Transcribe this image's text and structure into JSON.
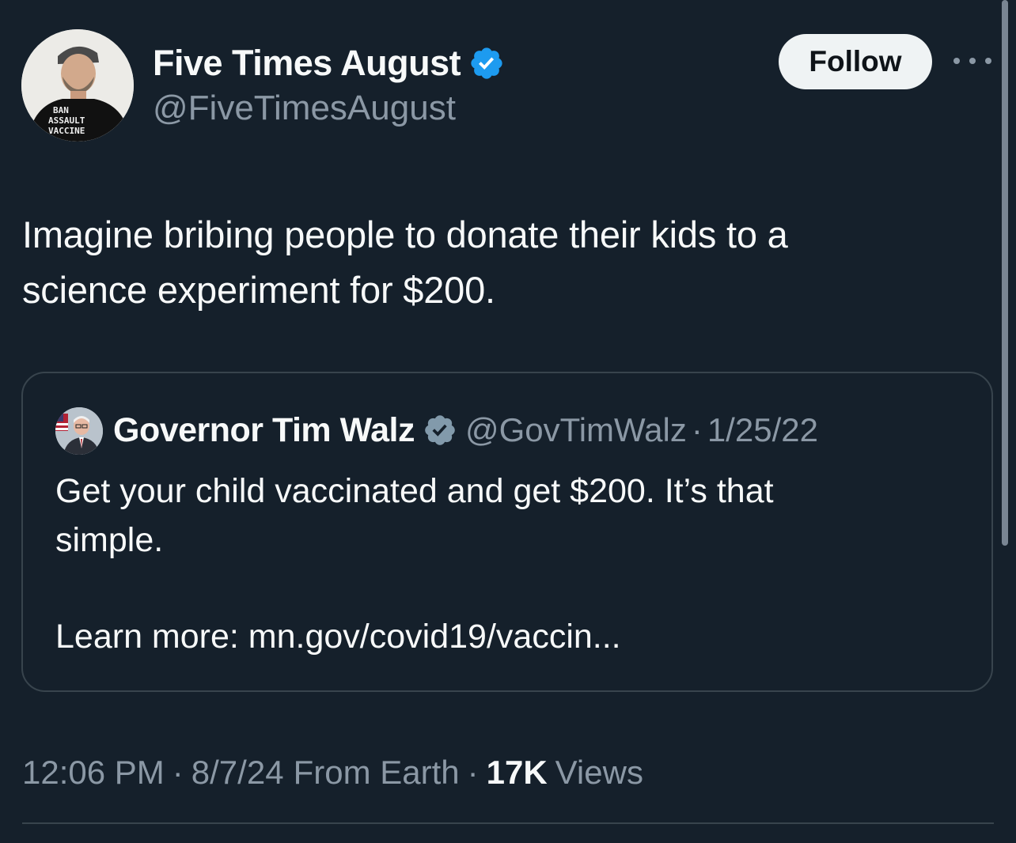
{
  "tweet": {
    "author": {
      "display_name": "Five Times August",
      "handle": "@FiveTimesAugust",
      "verified_icon": "verified-badge-icon",
      "avatar_shirt_text": [
        "BAN",
        "ASSAULT",
        "VACCINE"
      ]
    },
    "follow_label": "Follow",
    "more_icon": "more-horizontal-icon",
    "text_lines": [
      "Imagine bribing people to donate their kids to a",
      "science experiment for $200."
    ],
    "quote": {
      "display_name": "Governor Tim Walz",
      "handle": "@GovTimWalz",
      "separator": "·",
      "date": "1/25/22",
      "verified_icon": "verified-badge-icon",
      "body_lines": [
        "Get your child vaccinated and get $200. It’s that",
        "simple."
      ],
      "link_line": "Learn more: mn.gov/covid19/vaccin..."
    },
    "meta": {
      "time": "12:06 PM",
      "sep1": "·",
      "date": "8/7/24",
      "source": "From Earth",
      "sep2": "·",
      "views_count": "17K",
      "views_label": "Views"
    }
  },
  "colors": {
    "background": "#15202b",
    "primary_text": "#f7f9f9",
    "secondary_text": "#8b98a5",
    "border": "#38444d",
    "verified_blue": "#1d9bf0",
    "verified_gray": "#829aab",
    "follow_bg": "#eff3f4"
  }
}
